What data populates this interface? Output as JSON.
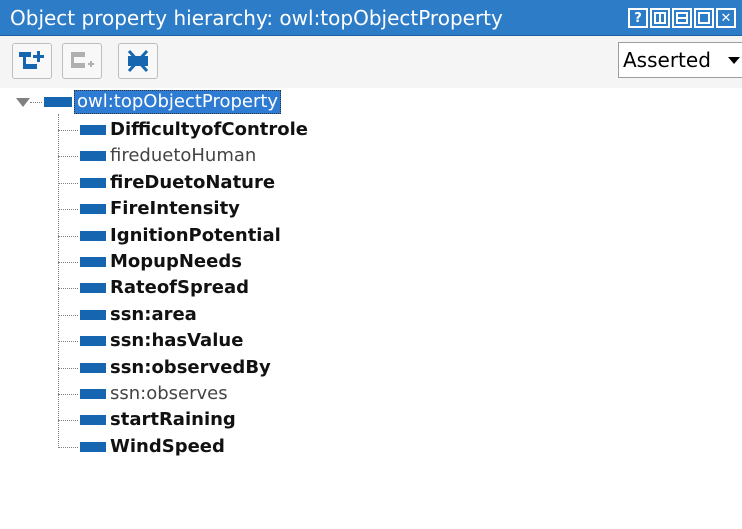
{
  "window": {
    "title": "Object property hierarchy: owl:topObjectProperty",
    "buttons": [
      {
        "name": "help-icon",
        "glyph": "?"
      },
      {
        "name": "split-vertical-icon",
        "glyph": ""
      },
      {
        "name": "split-horizontal-icon",
        "glyph": ""
      },
      {
        "name": "maximize-icon",
        "glyph": ""
      },
      {
        "name": "close-icon",
        "glyph": "✕"
      }
    ]
  },
  "toolbar": {
    "tools": [
      "add-sub-property-icon",
      "add-sibling-property-icon",
      "delete-property-icon"
    ],
    "view_mode": "Asserted"
  },
  "tree": {
    "root": "owl:topObjectProperty",
    "children": [
      {
        "label": "DifficultyofControle",
        "bold": true
      },
      {
        "label": "fireduetoHuman",
        "bold": false
      },
      {
        "label": "fireDuetoNature",
        "bold": true
      },
      {
        "label": "FireIntensity",
        "bold": true
      },
      {
        "label": "IgnitionPotential",
        "bold": true
      },
      {
        "label": "MopupNeeds",
        "bold": true
      },
      {
        "label": "RateofSpread",
        "bold": true
      },
      {
        "label": "ssn:area",
        "bold": true
      },
      {
        "label": "ssn:hasValue",
        "bold": true
      },
      {
        "label": "ssn:observedBy",
        "bold": true
      },
      {
        "label": "ssn:observes",
        "bold": false
      },
      {
        "label": "startRaining",
        "bold": true
      },
      {
        "label": "WindSpeed",
        "bold": true
      }
    ]
  },
  "colors": {
    "titlebar": "#2c7cc8",
    "property_icon": "#1565b0",
    "selection": "#2e7bd3"
  }
}
